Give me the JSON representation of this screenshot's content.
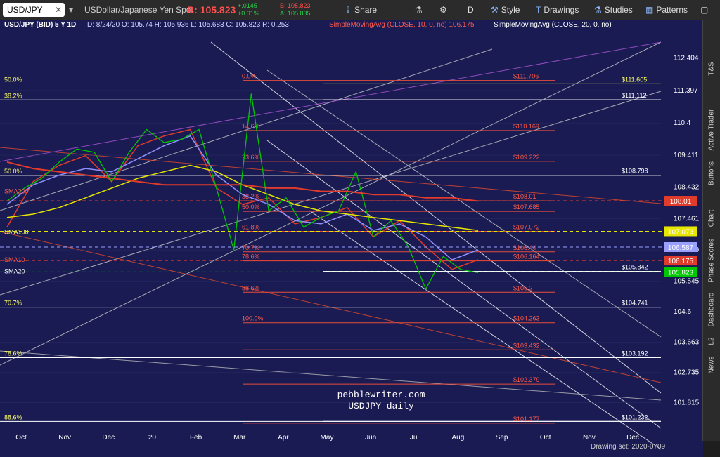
{
  "toolbar": {
    "symbol": "USD/JPY",
    "symbol_name": "USDollar/Japanese Yen Spot",
    "bid_label": "B: 105.823",
    "change": "+.0145",
    "change_pct": "+0.01%",
    "bid_small": "B: 105.823",
    "ask_small": "A: 105.835",
    "share": "Share",
    "period": "D",
    "style": "Style",
    "drawings": "Drawings",
    "studies": "Studies",
    "patterns": "Patterns"
  },
  "header": {
    "title": "USD/JPY (BID) 5 Y 1D",
    "ohlc": "D: 8/24/20   O: 105.74   H: 105.936   L: 105.683   C: 105.823   R: 0.253",
    "sma10": "SimpleMovingAvg (CLOSE, 10, 0, no)  106.175",
    "sma20": "SimpleMovingAvg (CLOSE, 20, 0, no)"
  },
  "side_tabs": [
    "Chart",
    "Phase Scores",
    "Dashboard",
    "L2",
    "News",
    "Buttons",
    "Active Trader",
    "T&S"
  ],
  "watermark": {
    "line1": "pebblewriter.com",
    "line2": "USDJPY daily"
  },
  "footer": "Drawing set: 2020-0709",
  "colors": {
    "bg": "#191b52",
    "price": "#00c800",
    "sma10": "#e03b2b",
    "sma20": "#8f8fff",
    "sma100": "#e6e600",
    "sma200": "#e03b2b",
    "fib": "#ffffff",
    "fibred": "#e74c3c"
  },
  "chart_data": {
    "type": "line",
    "title": "USD/JPY (BID) 5 Y 1D",
    "x_ticks": [
      "Oct",
      "Nov",
      "Dec",
      "20",
      "Feb",
      "Mar",
      "Apr",
      "May",
      "Jun",
      "Jul",
      "Aug",
      "Sep",
      "Oct",
      "Nov",
      "Dec"
    ],
    "y_ticks": [
      112.404,
      111.397,
      110.4,
      109.411,
      108.432,
      107.461,
      106.499,
      105.545,
      104.6,
      103.663,
      102.735,
      101.815
    ],
    "ylim": [
      100.85,
      113.1
    ],
    "price_badges": [
      {
        "label": "108.01",
        "value": 108.01,
        "color": "#e03b2b"
      },
      {
        "label": "107.073",
        "value": 107.073,
        "color": "#e6e600"
      },
      {
        "label": "106.587",
        "value": 106.587,
        "color": "#9aa0ff"
      },
      {
        "label": "106.175",
        "value": 106.175,
        "color": "#e03b2b"
      },
      {
        "label": "105.823",
        "value": 105.823,
        "color": "#00c800"
      }
    ],
    "fib_levels_left": [
      {
        "label": "50.0%",
        "value": 111.6
      },
      {
        "label": "38.2%",
        "value": 111.11
      },
      {
        "label": "50.0%",
        "value": 108.79
      },
      {
        "label": "70.7%",
        "value": 104.74
      },
      {
        "label": "78.6%",
        "value": 103.19
      },
      {
        "label": "88.6%",
        "value": 101.23
      }
    ],
    "fib_levels_right": [
      {
        "label": "$111.605",
        "value": 111.605,
        "color": "#ffff66"
      },
      {
        "label": "$111.112",
        "value": 111.112,
        "color": "#ffffff"
      },
      {
        "label": "$108.798",
        "value": 108.798,
        "color": "#ffffff"
      },
      {
        "label": "$105.842",
        "value": 105.842,
        "color": "#ffffff"
      },
      {
        "label": "$104.741",
        "value": 104.741,
        "color": "#ffffff"
      },
      {
        "label": "$103.192",
        "value": 103.192,
        "color": "#ffffff"
      },
      {
        "label": "$101.232",
        "value": 101.232,
        "color": "#ffffff"
      }
    ],
    "fib_levels_red": [
      {
        "label": "$111.706",
        "value": 111.706
      },
      {
        "label": "$110.169",
        "value": 110.169
      },
      {
        "label": "$109.222",
        "value": 109.222
      },
      {
        "label": "$108.01",
        "value": 108.01
      },
      {
        "label": "$107.685",
        "value": 107.685
      },
      {
        "label": "$107.072",
        "value": 107.072
      },
      {
        "label": "$106.44",
        "value": 106.44
      },
      {
        "label": "$106.164",
        "value": 106.164
      },
      {
        "label": "$105.2",
        "value": 105.2
      },
      {
        "label": "$104.263",
        "value": 104.263
      },
      {
        "label": "$103.432",
        "value": 103.432
      },
      {
        "label": "$102.379",
        "value": 102.379
      },
      {
        "label": "$101.177",
        "value": 101.177
      }
    ],
    "fib_pct_labels": [
      "0.0%",
      "14.6%",
      "23.6%",
      "38.2%",
      "50.0%",
      "61.8%",
      "70.7%",
      "78.6%",
      "88.6%",
      "100.0%"
    ],
    "ma_labels": [
      "SMA200",
      "SMA100",
      "SMA10",
      "SMA20"
    ],
    "series": [
      {
        "name": "SMA10",
        "values": [
          107.2,
          108.6,
          109.1,
          109.4,
          108.6,
          109.7,
          110.0,
          110.2,
          108.4,
          107.9,
          108.1,
          107.3,
          107.5,
          107.8,
          106.9,
          107.4,
          106.6,
          105.9,
          106.2
        ]
      },
      {
        "name": "SMA20",
        "values": [
          107.9,
          108.5,
          108.8,
          109.0,
          108.9,
          109.3,
          109.7,
          110.0,
          108.8,
          108.2,
          107.9,
          107.4,
          107.3,
          107.6,
          107.1,
          107.3,
          106.9,
          106.2,
          106.5
        ]
      },
      {
        "name": "SMA100",
        "values": [
          107.5,
          107.6,
          107.8,
          108.1,
          108.4,
          108.7,
          108.9,
          109.1,
          108.9,
          108.5,
          108.2,
          107.9,
          107.7,
          107.6,
          107.5,
          107.4,
          107.3,
          107.2,
          107.1
        ]
      },
      {
        "name": "SMA200",
        "values": [
          109.2,
          109.0,
          108.9,
          108.8,
          108.7,
          108.6,
          108.5,
          108.5,
          108.5,
          108.5,
          108.4,
          108.4,
          108.3,
          108.3,
          108.2,
          108.2,
          108.1,
          108.1,
          108.0
        ]
      }
    ],
    "close": [
      108.0,
      108.4,
      108.7,
      109.2,
      109.6,
      109.5,
      108.6,
      109.5,
      110.2,
      109.8,
      109.9,
      110.2,
      108.4,
      106.5,
      111.3,
      107.7,
      108.1,
      107.2,
      107.5,
      107.7,
      108.9,
      106.9,
      107.4,
      106.6,
      105.3,
      106.3,
      105.9,
      105.8
    ]
  }
}
